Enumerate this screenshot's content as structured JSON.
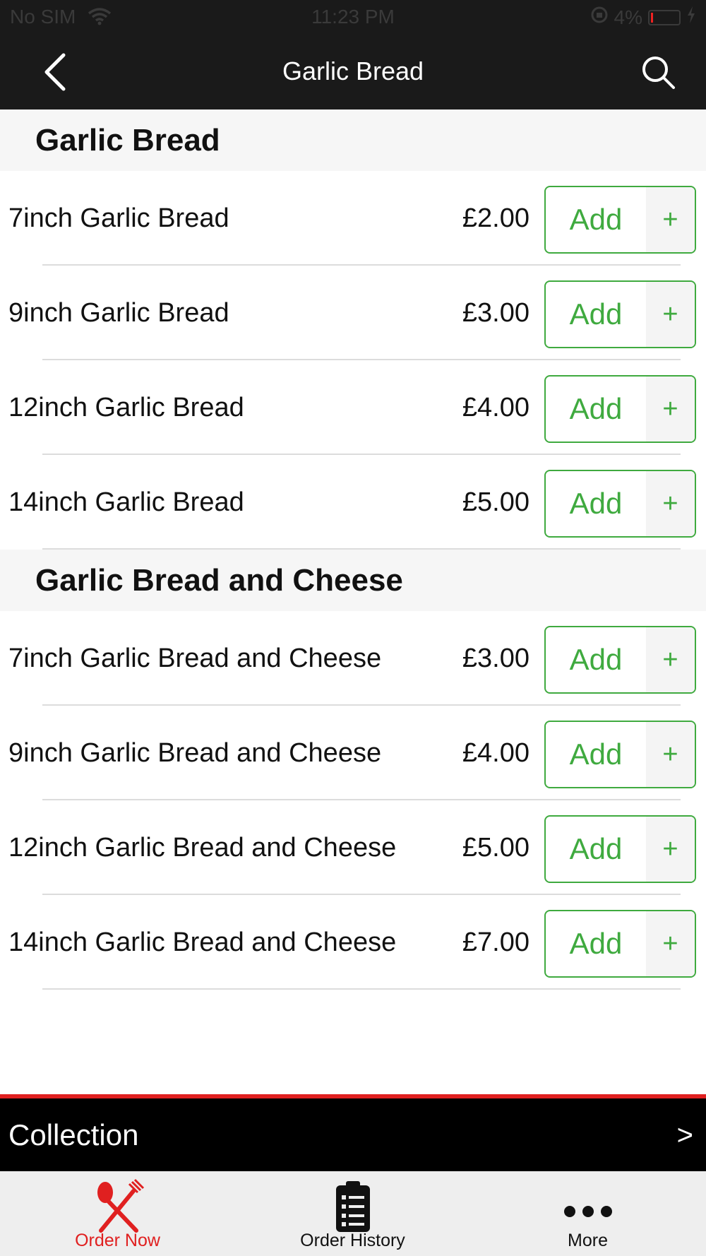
{
  "status_bar": {
    "carrier": "No SIM",
    "time": "11:23 PM",
    "battery": "4%"
  },
  "nav": {
    "title": "Garlic Bread",
    "back_icon": "chevron-left-icon",
    "search_icon": "search-icon"
  },
  "sections": [
    {
      "title": "Garlic Bread",
      "items": [
        {
          "name": "7inch Garlic Bread",
          "price": "£2.00"
        },
        {
          "name": "9inch Garlic Bread",
          "price": "£3.00"
        },
        {
          "name": "12inch Garlic Bread",
          "price": "£4.00"
        },
        {
          "name": "14inch Garlic Bread",
          "price": "£5.00"
        }
      ]
    },
    {
      "title": "Garlic Bread and Cheese",
      "items": [
        {
          "name": "7inch Garlic Bread and Cheese",
          "price": "£3.00"
        },
        {
          "name": "9inch Garlic Bread and Cheese",
          "price": "£4.00"
        },
        {
          "name": "12inch Garlic Bread and Cheese",
          "price": "£5.00"
        },
        {
          "name": "14inch Garlic Bread and Cheese",
          "price": "£7.00"
        }
      ]
    }
  ],
  "add_button": {
    "label": "Add",
    "plus": "+"
  },
  "collection": {
    "label": "Collection",
    "arrow": ">"
  },
  "tabs": [
    {
      "label": "Order Now",
      "icon": "fork-knife-icon"
    },
    {
      "label": "Order History",
      "icon": "clipboard-list-icon"
    },
    {
      "label": "More",
      "icon": "more-dots-icon"
    }
  ],
  "colors": {
    "accent_green": "#3faa3f",
    "accent_red": "#e02020",
    "nav_bg": "#1a1a1a"
  }
}
